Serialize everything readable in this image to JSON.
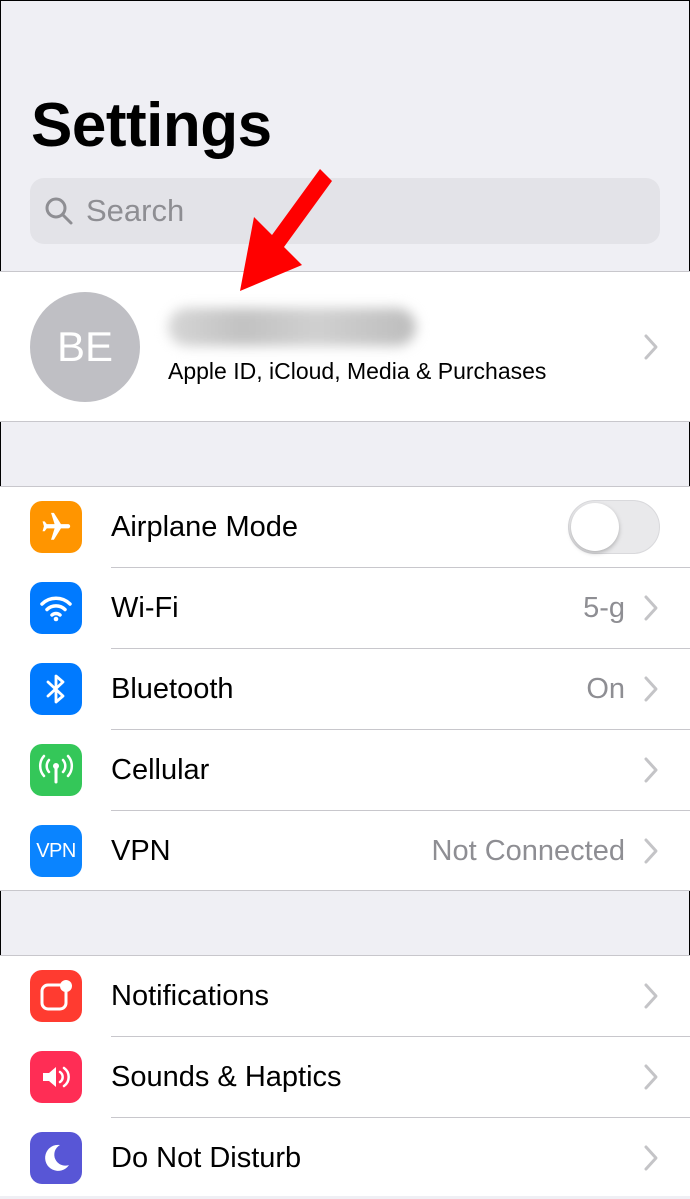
{
  "header": {
    "title": "Settings"
  },
  "search": {
    "placeholder": "Search"
  },
  "profile": {
    "initials": "BE",
    "subtitle": "Apple ID, iCloud, Media & Purchases"
  },
  "groups": [
    {
      "rows": [
        {
          "label": "Airplane Mode",
          "icon": "airplane-icon",
          "color": "#ff9500",
          "toggle": false
        },
        {
          "label": "Wi-Fi",
          "icon": "wifi-icon",
          "color": "#007aff",
          "value": "5-g"
        },
        {
          "label": "Bluetooth",
          "icon": "bluetooth-icon",
          "color": "#007aff",
          "value": "On"
        },
        {
          "label": "Cellular",
          "icon": "cellular-icon",
          "color": "#34c759"
        },
        {
          "label": "VPN",
          "icon": "vpn-icon",
          "color": "#0a84ff",
          "icon_text": "VPN",
          "value": "Not Connected"
        }
      ]
    },
    {
      "rows": [
        {
          "label": "Notifications",
          "icon": "notifications-icon",
          "color": "#ff3b30"
        },
        {
          "label": "Sounds & Haptics",
          "icon": "speaker-icon",
          "color": "#ff2d55"
        },
        {
          "label": "Do Not Disturb",
          "icon": "moon-icon",
          "color": "#5856d6"
        }
      ]
    }
  ],
  "annotation": {
    "arrow_color": "#ff0000"
  }
}
